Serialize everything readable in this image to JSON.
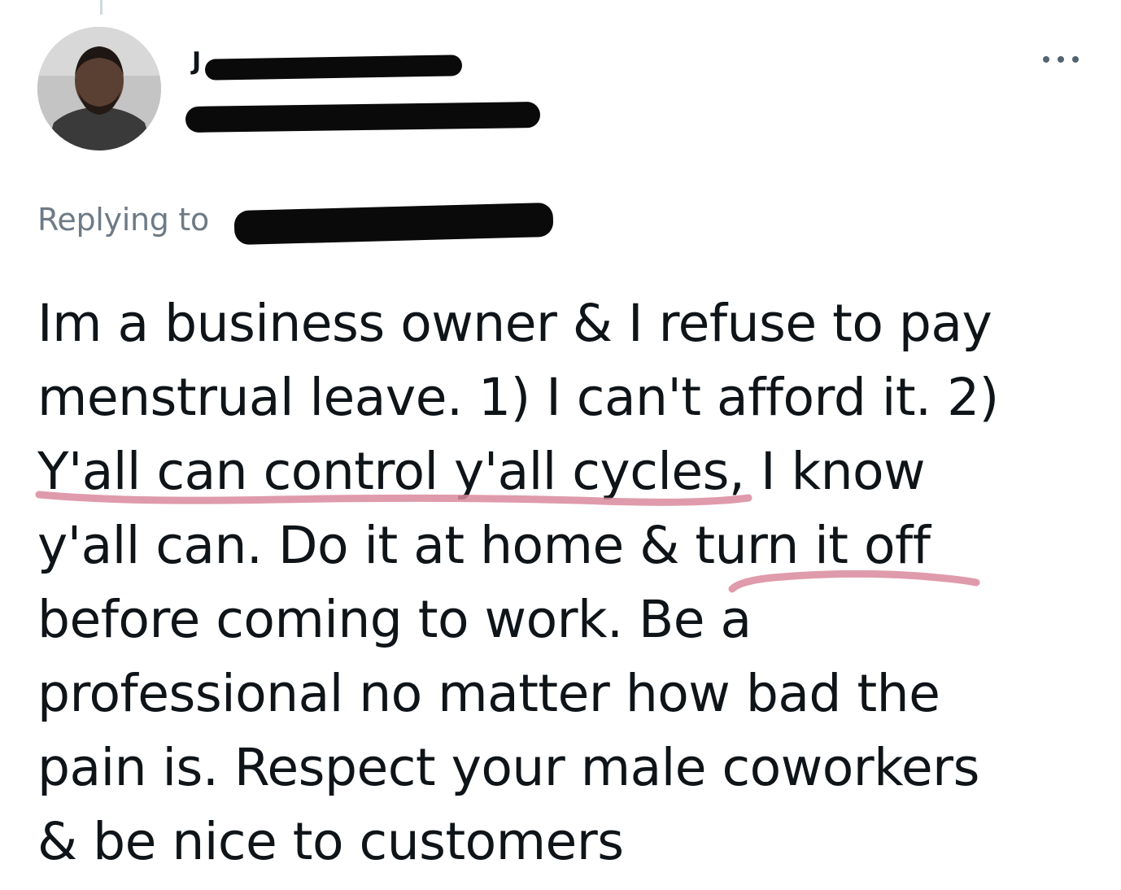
{
  "author": {
    "name_visible_initial": "J"
  },
  "reply_context": {
    "label": "Replying to"
  },
  "tweet": {
    "lines": [
      "Im a business owner & I refuse to pay",
      "menstrual leave. 1) I can't afford it. 2)",
      "Y'all can control y'all cycles, I know",
      "y'all can. Do it at home & turn it off",
      "before coming to work. Be a",
      "professional no matter how bad the",
      "pain is. Respect your male coworkers",
      "& be nice to customers"
    ]
  },
  "icons": {
    "more": "more-horizontal-icon",
    "avatar": "user-avatar"
  },
  "colors": {
    "text": "#0f1419",
    "secondary_text": "#6e7b86",
    "redaction": "#0a0a0a",
    "highlight_underline": "#d98a9c"
  }
}
